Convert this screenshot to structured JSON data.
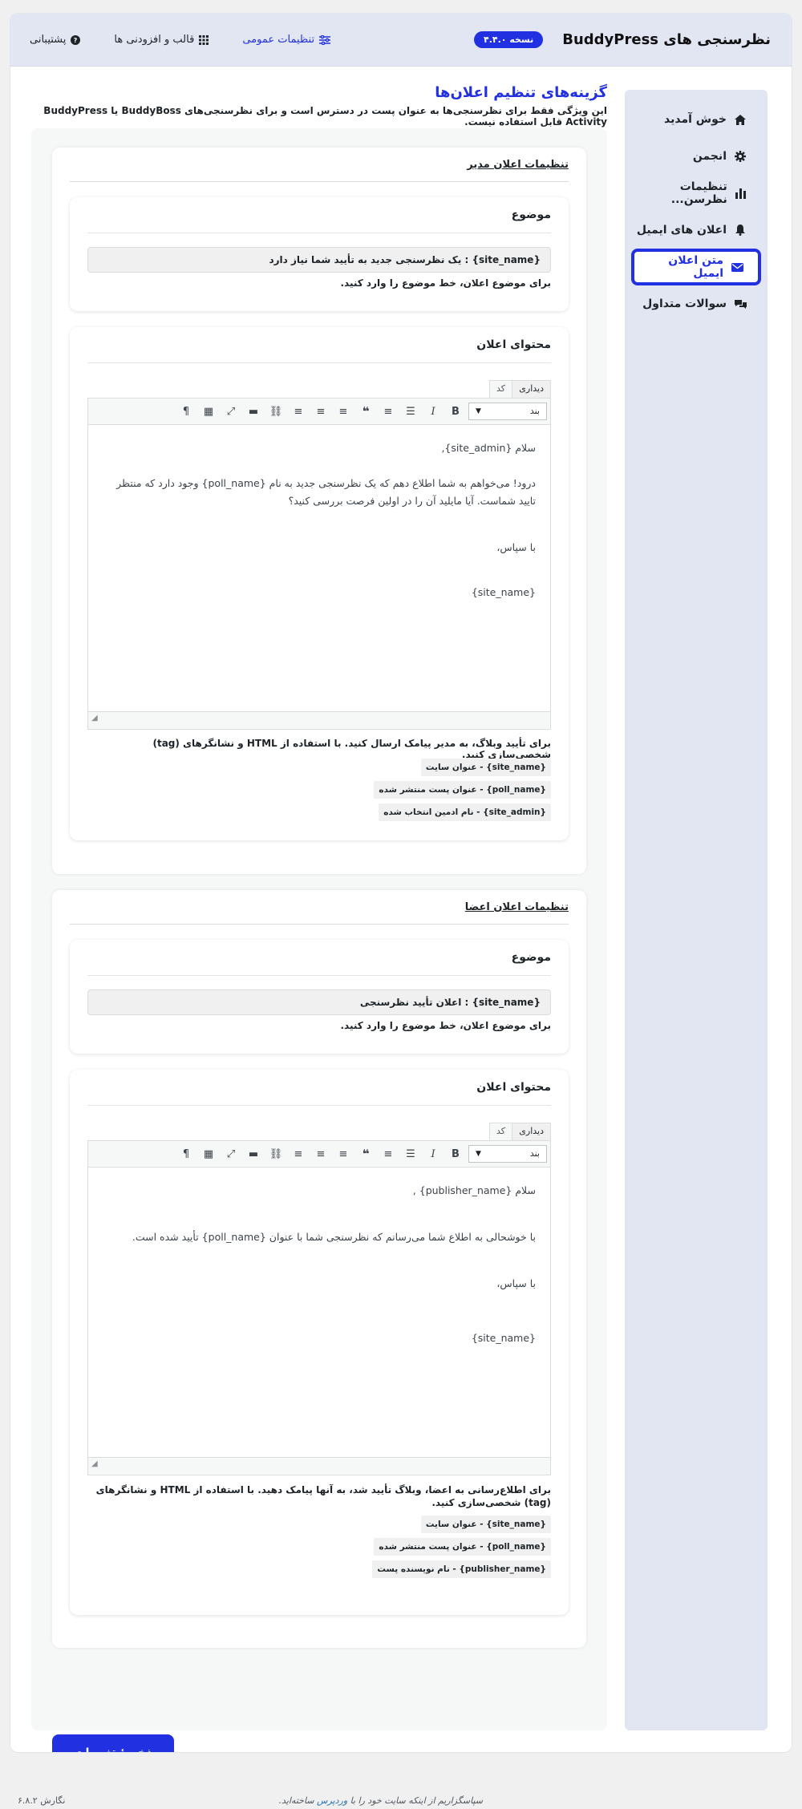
{
  "header": {
    "title": "نظرسنجی های BuddyPress",
    "version": "نسخه ۴.۴.۰",
    "nav": {
      "general": "تنظیمات عمومی",
      "templates": "قالب و افزودنی ها",
      "support": "پشتیبانی"
    }
  },
  "sidebar": {
    "items": [
      {
        "label": "خوش آمدید",
        "icon": "home-icon"
      },
      {
        "label": "انجمن",
        "icon": "gear-icon"
      },
      {
        "label": "تنظیمات نظرسن...",
        "icon": "bar-chart-icon"
      },
      {
        "label": "اعلان های ایمیل",
        "icon": "bell-icon"
      },
      {
        "label": "متن اعلان ایمیل",
        "icon": "envelope-icon"
      },
      {
        "label": "سوالات متداول",
        "icon": "chat-icon"
      }
    ],
    "active": "متن اعلان ایمیل"
  },
  "page": {
    "title": "گزینه‌های تنظیم اعلان‌ها",
    "description": "این ویژگی فقط برای نظرسنجی‌ها به عنوان پست در دسترس است و برای نظرسنجی‌های BuddyBoss یا BuddyPress Activity قابل استفاده نیست."
  },
  "admin_section": {
    "title": "تنظیمات اعلان مدیر",
    "subject_label": "موضوع",
    "subject_value": "{site_name} : یک نظرسنجی جدید به تأیید شما نیاز دارد",
    "subject_hint": "برای موضوع اعلان، خط موضوع را وارد کنید.",
    "content_label": "محتوای اعلان",
    "tab_visual": "دیداری",
    "tab_code": "کد",
    "format_select": "بند",
    "body": {
      "greeting": "سلام {site_admin},",
      "line1": "درود! می‌خواهم به شما اطلاع دهم که یک نظرسنجی جدید به نام {poll_name} وجود دارد که منتظر تایید شماست. آیا مایلید آن را در اولین فرصت بررسی کنید؟",
      "thanks": "با سپاس،",
      "signature": "{site_name}"
    },
    "content_hint": "برای تأیید وبلاگ، به مدیر پیامک ارسال کنید. با استفاده از HTML و نشانگرهای (tag) شخصی‌سازی کنید.",
    "tags": [
      "عنوان سایت - {site_name}",
      "عنوان پست منتشر شده - {poll_name}",
      "نام ادمین انتخاب شده - {site_admin}"
    ]
  },
  "member_section": {
    "title": "تنظیمات اعلان اعضا",
    "subject_label": "موضوع",
    "subject_value": "{site_name} : اعلان تأیید نظرسنجی",
    "subject_hint": "برای موضوع اعلان، خط موضوع را وارد کنید.",
    "content_label": "محتوای اعلان",
    "tab_visual": "دیداری",
    "tab_code": "کد",
    "format_select": "بند",
    "body": {
      "greeting": "سلام {publisher_name} ,",
      "line1": "با خوشحالی به اطلاع شما می‌رسانم که نظرسنجی شما با عنوان {poll_name} تأیید شده است.",
      "thanks": "با سپاس،",
      "signature": "{site_name}"
    },
    "content_hint": "برای اطلاع‌رسانی به اعضا، وبلاگ تأیید شد، به آنها پیامک دهید. با استفاده از HTML و نشانگرهای (tag) شخصی‌سازی کنید.",
    "tags": [
      "عنوان سایت - {site_name}",
      "عنوان پست منتشر شده - {poll_name}",
      "نام نویسنده پست - {publisher_name}"
    ]
  },
  "save_button": "ذخیرهٔ تغییرات",
  "footer": {
    "thanks_prefix": "سپاسگزاریم از اینکه سایت خود را با",
    "wordpress_link": "وردپرس",
    "thanks_suffix": "ساخته‌اید.",
    "version": "نگارش ۶.۸.۲"
  },
  "colors": {
    "accent": "#2130e0",
    "header_bg": "#e2e6f3",
    "sidebar_bg": "#e2e6f3"
  }
}
